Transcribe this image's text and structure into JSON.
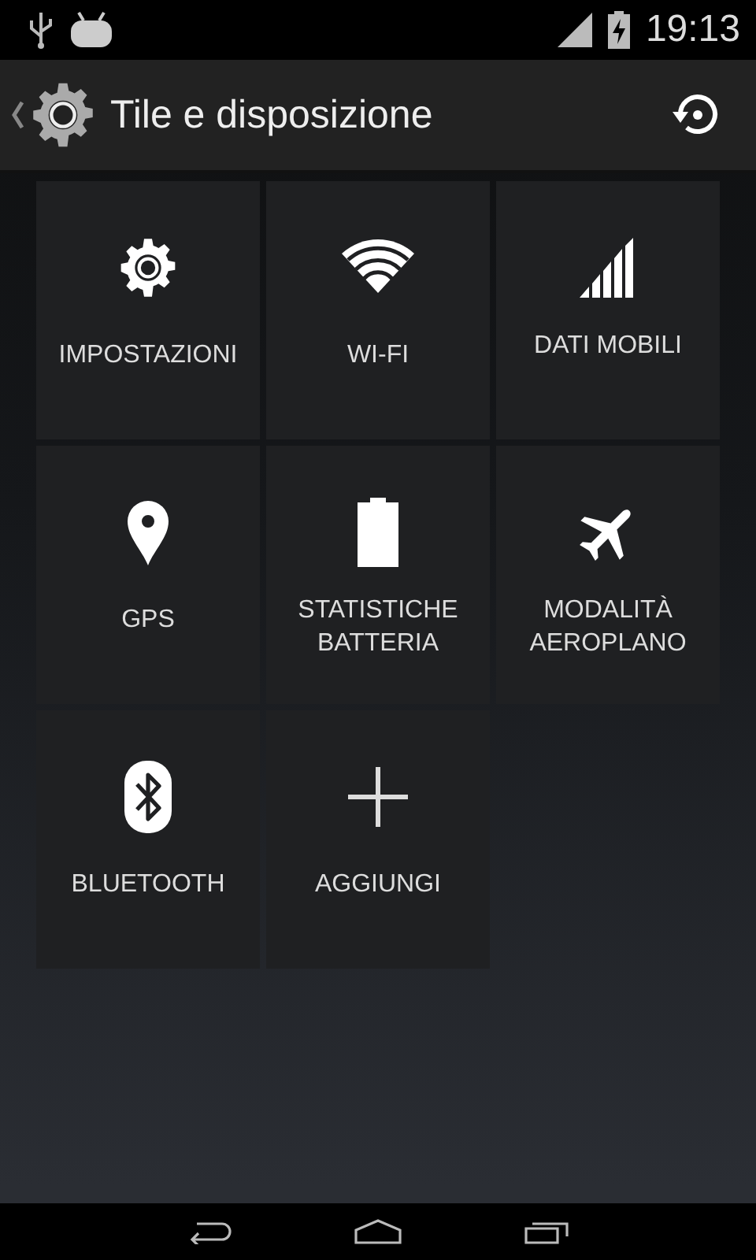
{
  "status_bar": {
    "time": "19:13"
  },
  "action_bar": {
    "title": "Tile e disposizione"
  },
  "tiles": [
    {
      "kind": "settings",
      "label": "IMPOSTAZIONI"
    },
    {
      "kind": "wifi",
      "label": "WI-FI"
    },
    {
      "kind": "signal",
      "label": "DATI MOBILI"
    },
    {
      "kind": "gps",
      "label": "GPS"
    },
    {
      "kind": "battery",
      "label": "STATISTICHE BATTERIA"
    },
    {
      "kind": "airplane",
      "label": "MODALITÀ AEROPLANO"
    },
    {
      "kind": "bluetooth",
      "label": "BLUETOOTH"
    },
    {
      "kind": "add",
      "label": "AGGIUNGI"
    }
  ]
}
